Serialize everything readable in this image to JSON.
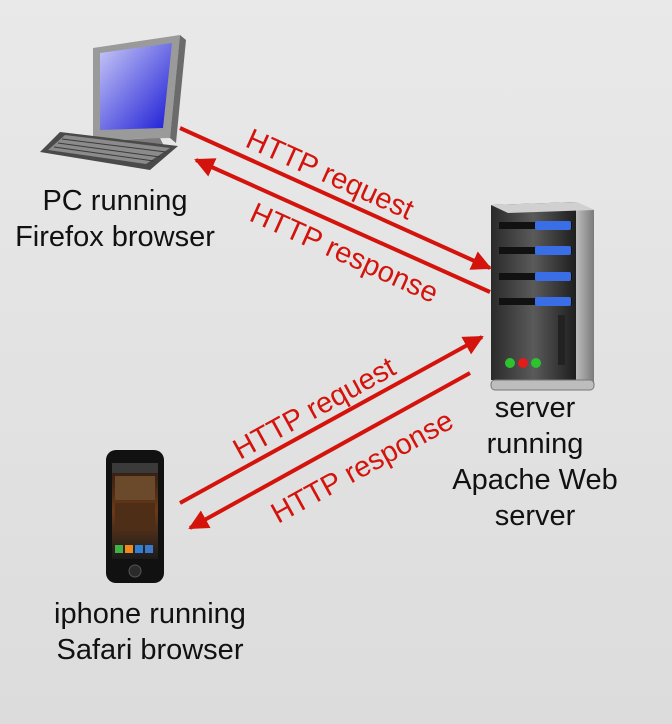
{
  "colors": {
    "arrow": "#d4140c",
    "background": "#e2e2e2"
  },
  "nodes": {
    "pc": {
      "icon": "desktop-computer-icon",
      "label_lines": [
        "PC running",
        "Firefox browser"
      ]
    },
    "server": {
      "icon": "server-tower-icon",
      "label_lines": [
        "server",
        "running",
        "Apache Web",
        "server"
      ]
    },
    "iphone": {
      "icon": "smartphone-icon",
      "label_lines": [
        "iphone running",
        "Safari browser"
      ]
    }
  },
  "messages": {
    "pc_request": "HTTP request",
    "pc_response": "HTTP response",
    "iphone_request": "HTTP request",
    "iphone_response": "HTTP response"
  }
}
